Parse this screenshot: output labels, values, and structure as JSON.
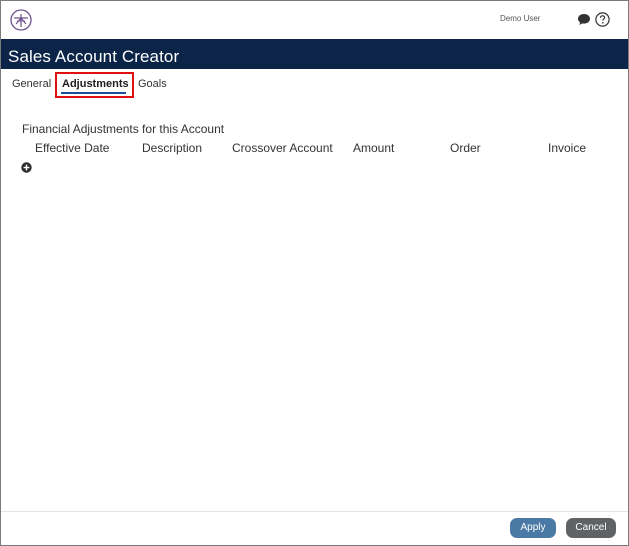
{
  "header": {
    "user_name": "Demo User",
    "logo_icon": "brand-logo-icon",
    "chat_icon": "chat-bubble-icon",
    "help_icon": "help-circle-icon"
  },
  "page": {
    "title": "Sales Account Creator"
  },
  "tabs": [
    {
      "label": "General",
      "active": false
    },
    {
      "label": "Adjustments",
      "active": true
    },
    {
      "label": "Goals",
      "active": false
    }
  ],
  "adjustments": {
    "section_title": "Financial Adjustments for this Account",
    "columns": [
      "Effective Date",
      "Description",
      "Crossover Account",
      "Amount",
      "Order",
      "Invoice"
    ],
    "rows": [],
    "add_icon": "plus-circle-icon"
  },
  "footer": {
    "apply_label": "Apply",
    "cancel_label": "Cancel"
  },
  "colors": {
    "title_bar": "#0b2447",
    "apply_button": "#4a79a6",
    "cancel_button": "#606264",
    "highlight": "#e01010",
    "logo": "#6b4e8a"
  }
}
